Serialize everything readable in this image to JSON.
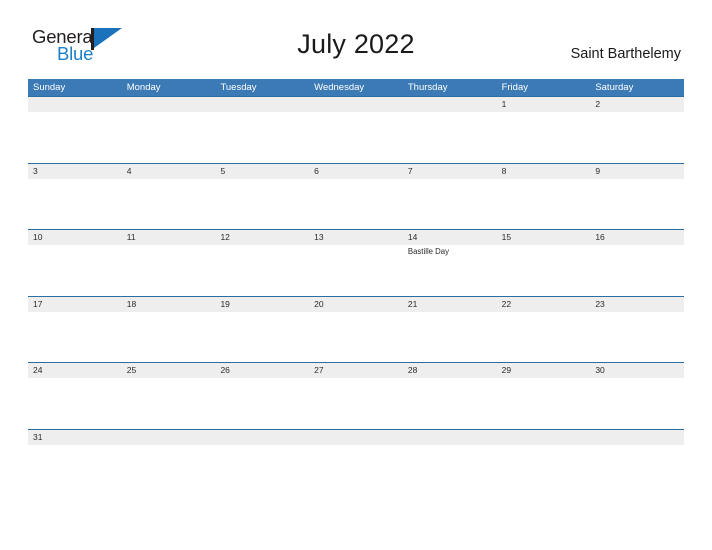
{
  "brand": {
    "name_primary": "General",
    "name_secondary": "Blue",
    "mark": "flag-triangle"
  },
  "header": {
    "title": "July 2022",
    "region": "Saint Barthelemy"
  },
  "colors": {
    "header_blue": "#3c7ab5",
    "rule_blue": "#2e6da4",
    "number_band_gray": "#eeeeee",
    "logo_blue": "#1b7fc4",
    "text_dark": "#1a1a1a"
  },
  "calendar": {
    "weekdays": [
      "Sunday",
      "Monday",
      "Tuesday",
      "Wednesday",
      "Thursday",
      "Friday",
      "Saturday"
    ],
    "weeks": [
      {
        "days": [
          {
            "num": "",
            "event": ""
          },
          {
            "num": "",
            "event": ""
          },
          {
            "num": "",
            "event": ""
          },
          {
            "num": "",
            "event": ""
          },
          {
            "num": "",
            "event": ""
          },
          {
            "num": "1",
            "event": ""
          },
          {
            "num": "2",
            "event": ""
          }
        ]
      },
      {
        "days": [
          {
            "num": "3",
            "event": ""
          },
          {
            "num": "4",
            "event": ""
          },
          {
            "num": "5",
            "event": ""
          },
          {
            "num": "6",
            "event": ""
          },
          {
            "num": "7",
            "event": ""
          },
          {
            "num": "8",
            "event": ""
          },
          {
            "num": "9",
            "event": ""
          }
        ]
      },
      {
        "days": [
          {
            "num": "10",
            "event": ""
          },
          {
            "num": "11",
            "event": ""
          },
          {
            "num": "12",
            "event": ""
          },
          {
            "num": "13",
            "event": ""
          },
          {
            "num": "14",
            "event": "Bastille Day"
          },
          {
            "num": "15",
            "event": ""
          },
          {
            "num": "16",
            "event": ""
          }
        ]
      },
      {
        "days": [
          {
            "num": "17",
            "event": ""
          },
          {
            "num": "18",
            "event": ""
          },
          {
            "num": "19",
            "event": ""
          },
          {
            "num": "20",
            "event": ""
          },
          {
            "num": "21",
            "event": ""
          },
          {
            "num": "22",
            "event": ""
          },
          {
            "num": "23",
            "event": ""
          }
        ]
      },
      {
        "days": [
          {
            "num": "24",
            "event": ""
          },
          {
            "num": "25",
            "event": ""
          },
          {
            "num": "26",
            "event": ""
          },
          {
            "num": "27",
            "event": ""
          },
          {
            "num": "28",
            "event": ""
          },
          {
            "num": "29",
            "event": ""
          },
          {
            "num": "30",
            "event": ""
          }
        ]
      },
      {
        "days": [
          {
            "num": "31",
            "event": ""
          },
          {
            "num": "",
            "event": ""
          },
          {
            "num": "",
            "event": ""
          },
          {
            "num": "",
            "event": ""
          },
          {
            "num": "",
            "event": ""
          },
          {
            "num": "",
            "event": ""
          },
          {
            "num": "",
            "event": ""
          }
        ]
      }
    ]
  }
}
